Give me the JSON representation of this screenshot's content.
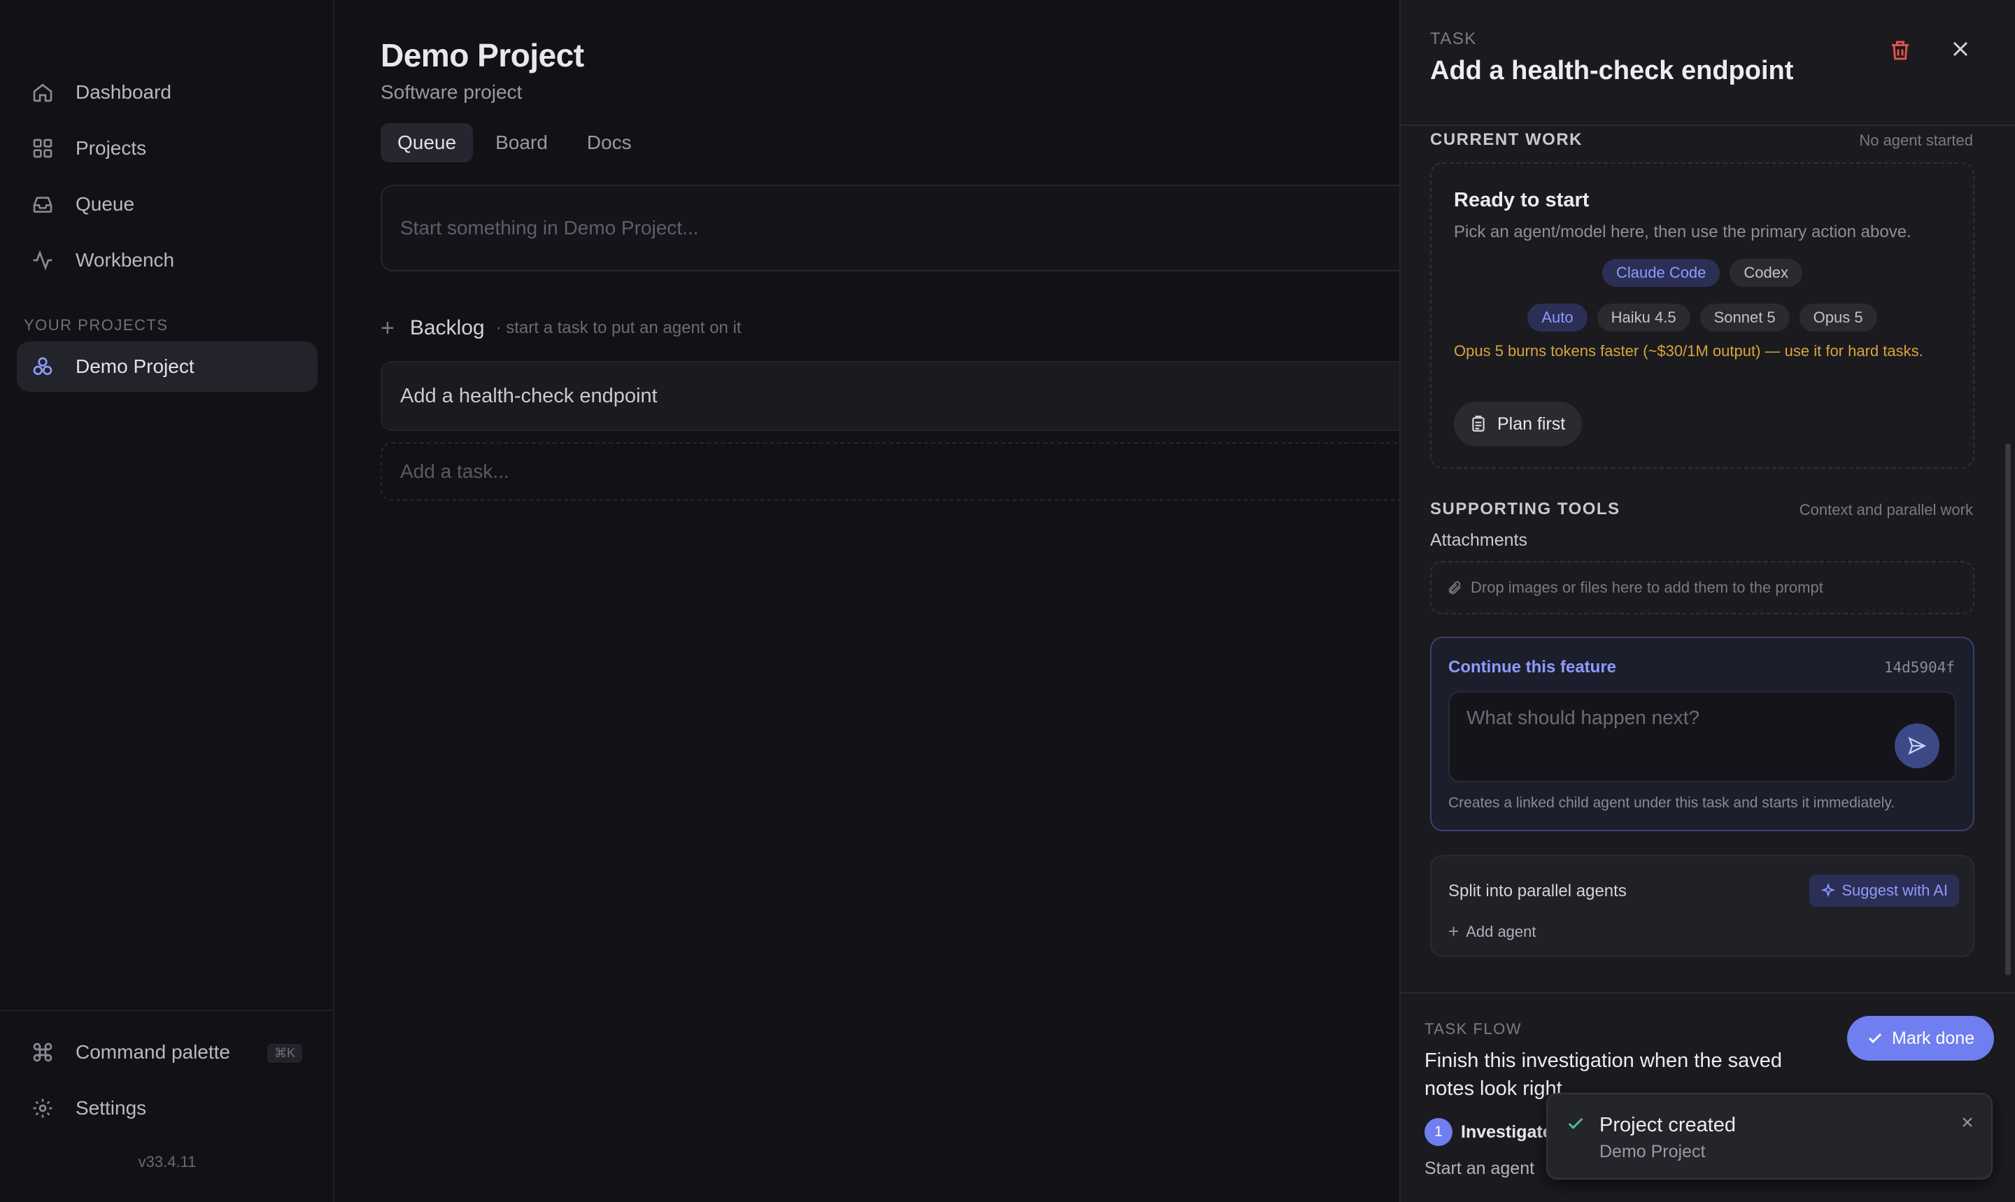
{
  "sidebar": {
    "nav": [
      {
        "label": "Dashboard",
        "icon": "home-icon"
      },
      {
        "label": "Projects",
        "icon": "grid-icon"
      },
      {
        "label": "Queue",
        "icon": "inbox-icon"
      },
      {
        "label": "Workbench",
        "icon": "activity-icon"
      }
    ],
    "section_label": "YOUR PROJECTS",
    "projects": [
      {
        "label": "Demo Project",
        "icon": "project-icon"
      }
    ],
    "footer": [
      {
        "label": "Command palette",
        "icon": "command-icon",
        "shortcut": "⌘K"
      },
      {
        "label": "Settings",
        "icon": "gear-icon"
      }
    ],
    "version": "v33.4.11"
  },
  "main": {
    "title": "Demo Project",
    "subtitle": "Software project",
    "tabs": [
      "Queue",
      "Board",
      "Docs"
    ],
    "active_tab": "Queue",
    "composer_placeholder": "Start something in Demo Project...",
    "backlog": {
      "label": "Backlog",
      "hint": "· start a task to put an agent on it"
    },
    "tasks": [
      "Add a health-check endpoint"
    ],
    "add_task_placeholder": "Add a task..."
  },
  "panel": {
    "eyebrow": "TASK",
    "title": "Add a health-check endpoint",
    "current_work": {
      "heading": "CURRENT WORK",
      "status": "No agent started",
      "ready_title": "Ready to start",
      "ready_desc": "Pick an agent/model here, then use the primary action above.",
      "agents": [
        "Claude Code",
        "Codex"
      ],
      "selected_agent": "Claude Code",
      "models": [
        "Auto",
        "Haiku 4.5",
        "Sonnet 5",
        "Opus 5"
      ],
      "selected_model": "Auto",
      "warning": "Opus 5 burns tokens faster (~$30/1M output) — use it for hard tasks.",
      "plan_button": "Plan first"
    },
    "supporting_tools": {
      "heading": "SUPPORTING TOOLS",
      "meta": "Context and parallel work",
      "attachments_label": "Attachments",
      "attachments_hint": "Drop images or files here to add them to the prompt"
    },
    "continue": {
      "title": "Continue this feature",
      "hash": "14d5904f",
      "placeholder": "What should happen next?",
      "footnote": "Creates a linked child agent under this task and starts it immediately."
    },
    "split": {
      "title": "Split into parallel agents",
      "suggest_button": "Suggest with AI",
      "add_agent": "Add agent"
    },
    "flow": {
      "eyebrow": "TASK FLOW",
      "text": "Finish this investigation when the saved notes look right.",
      "mark_done": "Mark done",
      "step_number": "1",
      "step_label": "Investigate",
      "step_sub": "Start an agent"
    }
  },
  "toast": {
    "title": "Project created",
    "subtitle": "Demo Project"
  },
  "colors": {
    "accent": "#6f7ff0",
    "accent_text": "#8e9bff",
    "warning": "#d8a53a",
    "danger": "#e0524a",
    "background": "#111116",
    "panel": "#1a1a1f"
  }
}
